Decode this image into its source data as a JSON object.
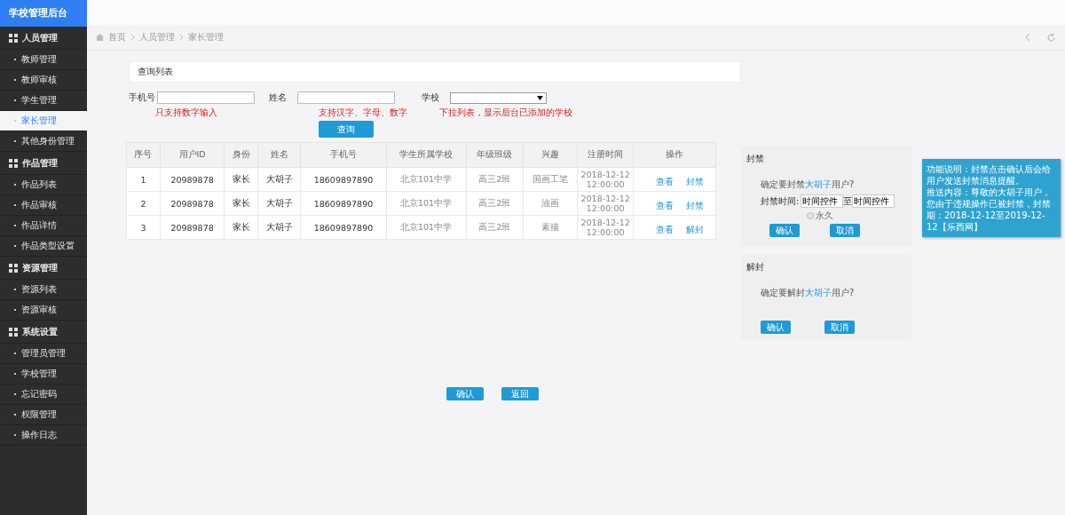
{
  "sidebar": {
    "title": "学校管理后台",
    "groups": [
      {
        "label": "人员管理",
        "items": [
          {
            "label": "教师管理",
            "selected": false
          },
          {
            "label": "教师审核",
            "selected": false
          },
          {
            "label": "学生管理",
            "selected": false
          },
          {
            "label": "家长管理",
            "selected": true
          },
          {
            "label": "其他身份管理",
            "selected": false
          }
        ]
      },
      {
        "label": "作品管理",
        "items": [
          {
            "label": "作品列表",
            "selected": false
          },
          {
            "label": "作品审核",
            "selected": false
          },
          {
            "label": "作品详情",
            "selected": false
          },
          {
            "label": "作品类型设置",
            "selected": false
          }
        ]
      },
      {
        "label": "资源管理",
        "items": [
          {
            "label": "资源列表",
            "selected": false
          },
          {
            "label": "资源审核",
            "selected": false
          }
        ]
      },
      {
        "label": "系统设置",
        "items": [
          {
            "label": "管理员管理",
            "selected": false
          },
          {
            "label": "学校管理",
            "selected": false
          },
          {
            "label": "忘记密码",
            "selected": false
          },
          {
            "label": "权限管理",
            "selected": false
          },
          {
            "label": "操作日志",
            "selected": false
          }
        ]
      }
    ]
  },
  "breadcrumb": [
    "首页",
    "人员管理",
    "家长管理"
  ],
  "search": {
    "title": "查询列表",
    "fields": [
      {
        "label": "手机号",
        "kind": "text",
        "hint": "只支持数字输入"
      },
      {
        "label": "姓名",
        "kind": "text",
        "hint": "支持汉字、字母、数字"
      },
      {
        "label": "学校",
        "kind": "select",
        "hint": "下拉列表，显示后台已添加的学校"
      }
    ],
    "button": "查询"
  },
  "table": {
    "columns": [
      "序号",
      "用户ID",
      "身份",
      "姓名",
      "手机号",
      "学生所属学校",
      "年级班级",
      "兴趣",
      "注册时间",
      "操作"
    ],
    "rows": [
      {
        "cells": [
          "1",
          "20989878",
          "家长",
          "大胡子",
          "18609897890",
          "北京101中学",
          "高三2班",
          "国画工笔",
          "2018-12-12 12:00:00"
        ],
        "actions": [
          "查看",
          "封禁"
        ]
      },
      {
        "cells": [
          "2",
          "20989878",
          "家长",
          "大胡子",
          "18609897890",
          "北京101中学",
          "高三2班",
          "油画",
          "2018-12-12 12:00:00"
        ],
        "actions": [
          "查看",
          "封禁"
        ]
      },
      {
        "cells": [
          "3",
          "20989878",
          "家长",
          "大胡子",
          "18609897890",
          "北京101中学",
          "高三2班",
          "素描",
          "2018-12-12 12:00:00"
        ],
        "actions": [
          "查看",
          "解封"
        ]
      }
    ]
  },
  "footer_buttons": [
    "确认",
    "返回"
  ],
  "ban_panel": {
    "title": "封禁",
    "prompt_before": "确定要封禁",
    "user": "大胡子",
    "prompt_after": "用户?",
    "time_label": "封禁时间:",
    "time_from": "时间控件",
    "separator": "至",
    "time_to": "时间控件",
    "radio": {
      "label": "永久",
      "selected": false
    },
    "buttons": [
      "确认",
      "取消"
    ]
  },
  "unban_panel": {
    "title": "解封",
    "prompt_before": "确定要解封",
    "user": "大胡子",
    "prompt_after": "用户?",
    "buttons": [
      "确认",
      "取消"
    ]
  },
  "notice": [
    "功能说明：封禁点击确认后会给用户发送封禁消息提醒。",
    "推送内容：尊敬的大胡子用户，您由于违规操作已被封禁，封禁期：2018-12-12至2019-12-12【乐西网】"
  ]
}
